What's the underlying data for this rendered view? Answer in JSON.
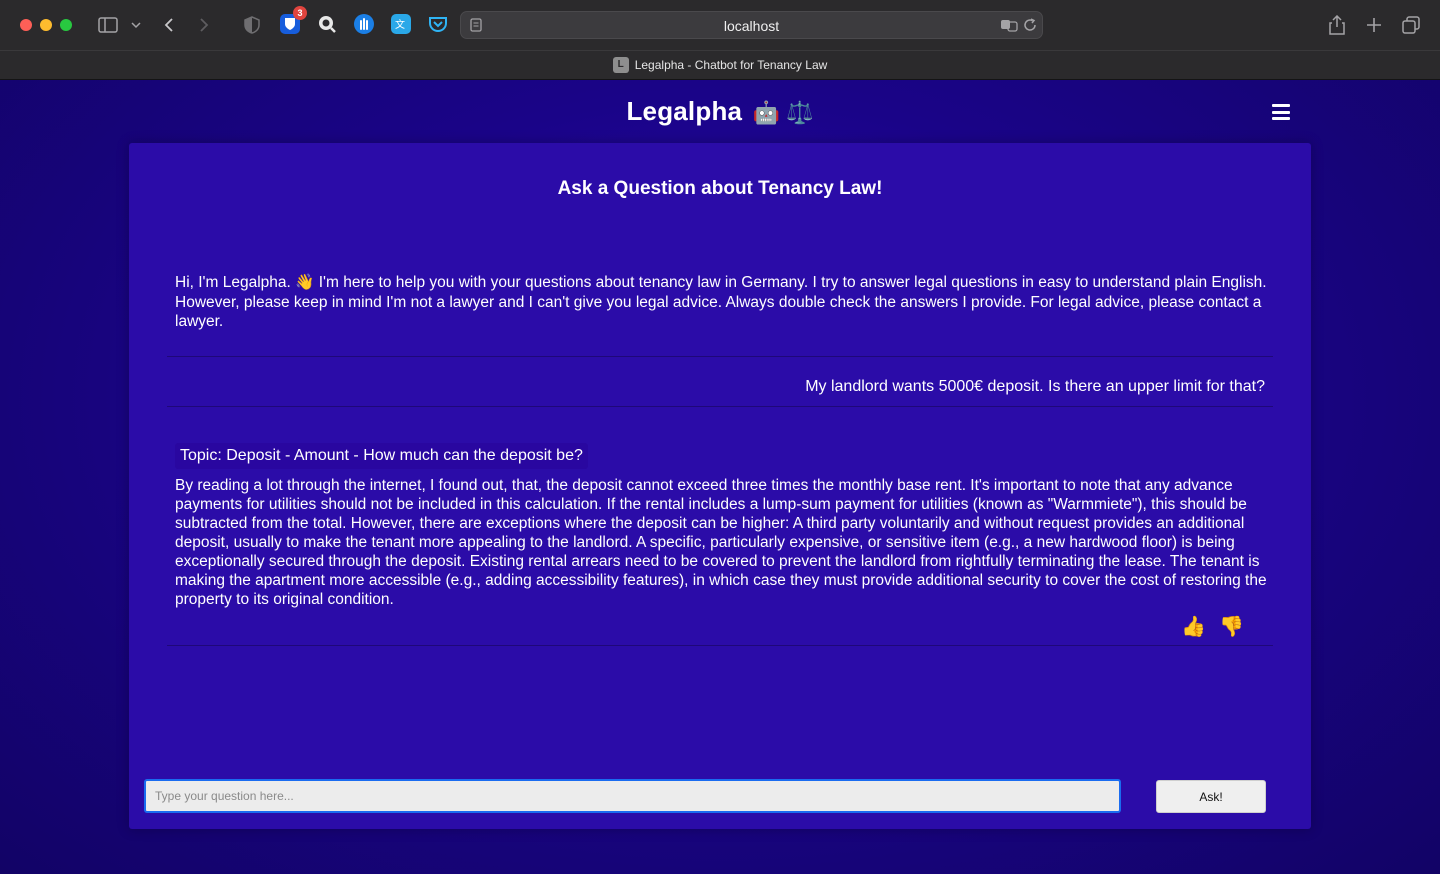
{
  "browser": {
    "url": "localhost",
    "tab_title": "Legalpha - Chatbot for Tenancy Law",
    "favicon_letter": "L",
    "extension_badge": "3"
  },
  "app": {
    "title": "Legalpha",
    "title_emoji": "🤖 ⚖️",
    "menu_icon": "hamburger-icon"
  },
  "chat": {
    "heading": "Ask a Question about Tenancy Law!",
    "intro_message": "Hi, I'm Legalpha. 👋 I'm here to help you with your questions about tenancy law in Germany. I try to answer legal questions in easy to understand plain English. However, please keep in mind I'm not a lawyer and I can't give you legal advice. Always double check the answers I provide. For legal advice, please contact a lawyer.",
    "user_message": "My landlord wants 5000€ deposit. Is there an upper limit for that?",
    "answer_topic": "Topic: Deposit - Amount - How much can the deposit be?",
    "answer_text": "By reading a lot through the internet, I found out, that, the deposit cannot exceed three times the monthly base rent. It's important to note that any advance payments for utilities should not be included in this calculation. If the rental includes a lump-sum payment for utilities (known as \"Warmmiete\"), this should be subtracted from the total. However, there are exceptions where the deposit can be higher: A third party voluntarily and without request provides an additional deposit, usually to make the tenant more appealing to the landlord. A specific, particularly expensive, or sensitive item (e.g., a new hardwood floor) is being exceptionally secured through the deposit. Existing rental arrears need to be covered to prevent the landlord from rightfully terminating the lease. The tenant is making the apartment more accessible (e.g., adding accessibility features), in which case they must provide additional security to cover the cost of restoring the property to its original condition.",
    "thumbs_up": "👍",
    "thumbs_down": "👎"
  },
  "input": {
    "placeholder": "Type your question here...",
    "value": "",
    "button_label": "Ask!"
  }
}
